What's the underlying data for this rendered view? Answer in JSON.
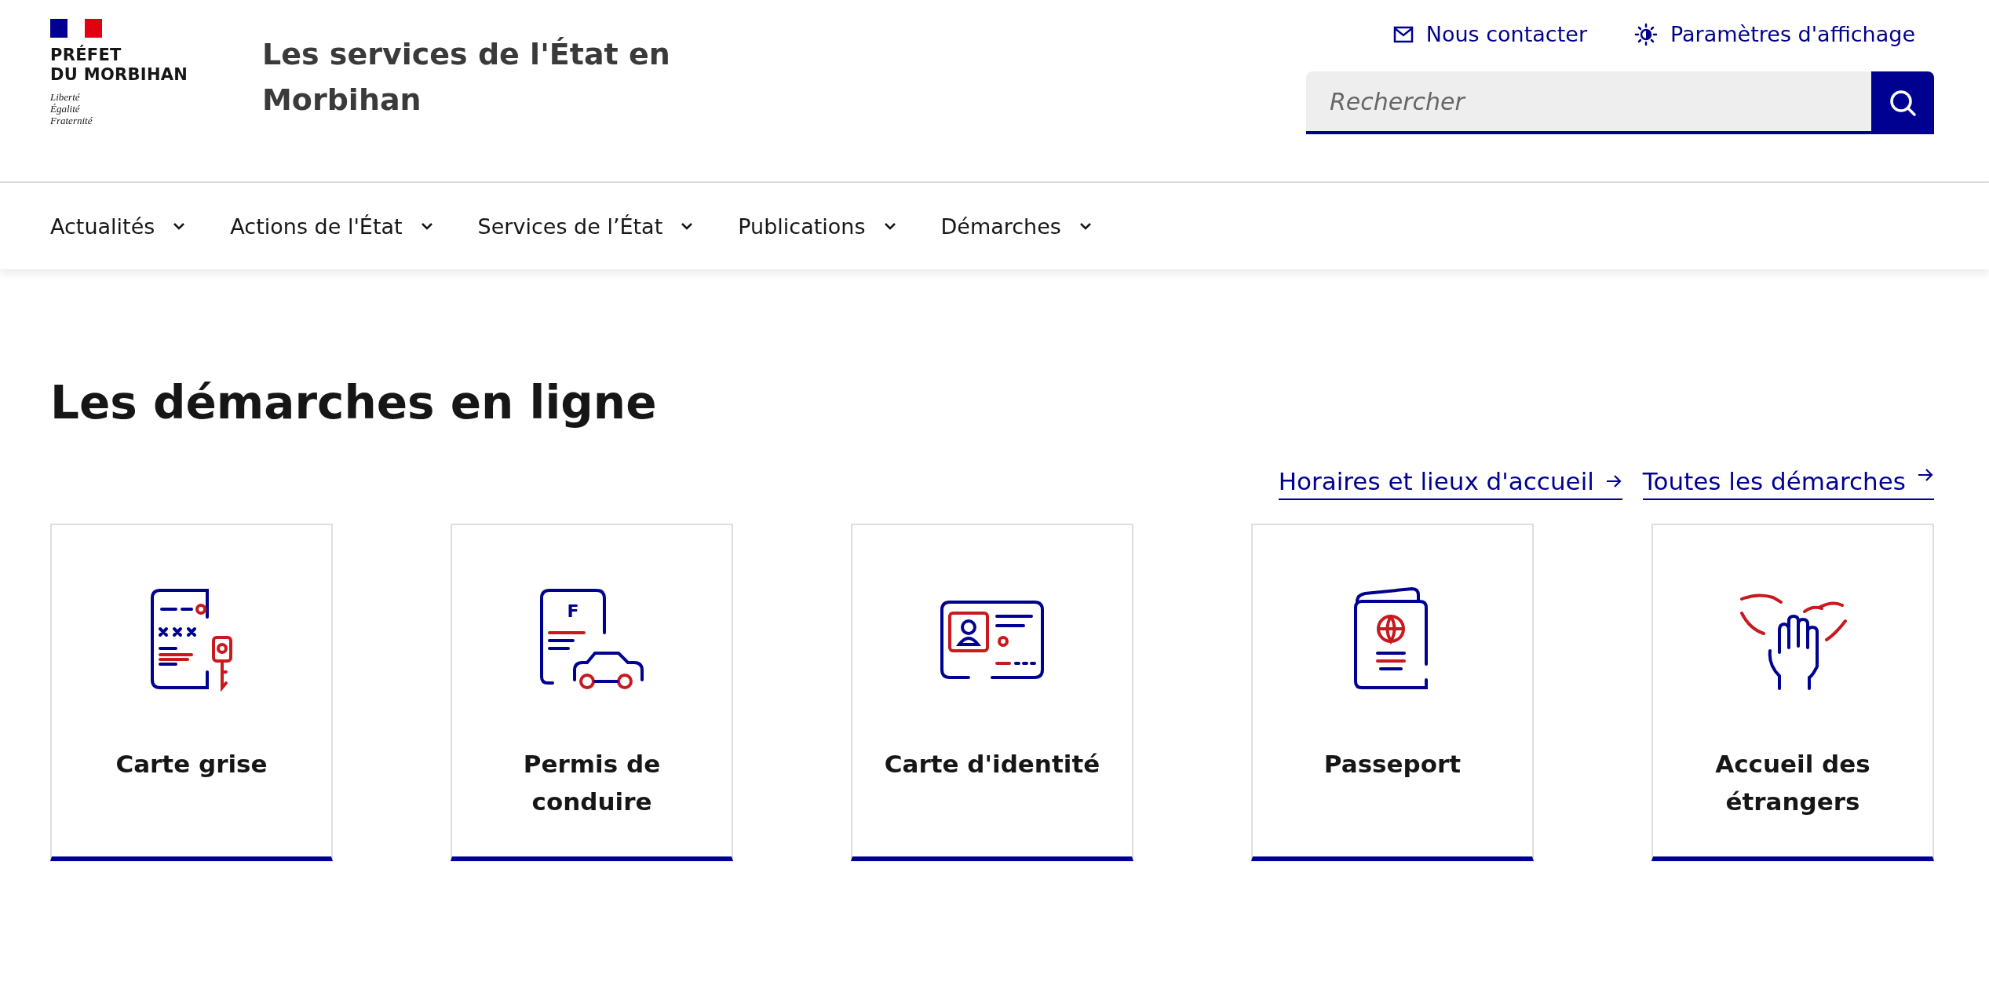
{
  "logo": {
    "lines": [
      "PRÉFET",
      "DU MORBIHAN"
    ],
    "motto": [
      "Liberté",
      "Égalité",
      "Fraternité"
    ]
  },
  "site_title": "Les services de l'État en Morbihan",
  "header_links": [
    {
      "kind": "mail",
      "label": "Nous contacter"
    },
    {
      "kind": "display",
      "label": "Paramètres d'affichage"
    }
  ],
  "search": {
    "placeholder": "Rechercher"
  },
  "nav": [
    {
      "label": "Actualités"
    },
    {
      "label": "Actions de l'État"
    },
    {
      "label": "Services de l’État"
    },
    {
      "label": "Publications"
    },
    {
      "label": "Démarches"
    }
  ],
  "heading": "Les démarches en ligne",
  "links": [
    "Horaires et lieux d'accueil",
    "Toutes les démarches"
  ],
  "cards": [
    {
      "kind": "registration",
      "label": "Carte grise"
    },
    {
      "kind": "license",
      "emblem": "F",
      "label": "Permis de conduire"
    },
    {
      "kind": "idcard",
      "label": "Carte d'identité"
    },
    {
      "kind": "passport",
      "label": "Passeport"
    },
    {
      "kind": "welcome",
      "label": "Accueil des étrangers"
    }
  ]
}
